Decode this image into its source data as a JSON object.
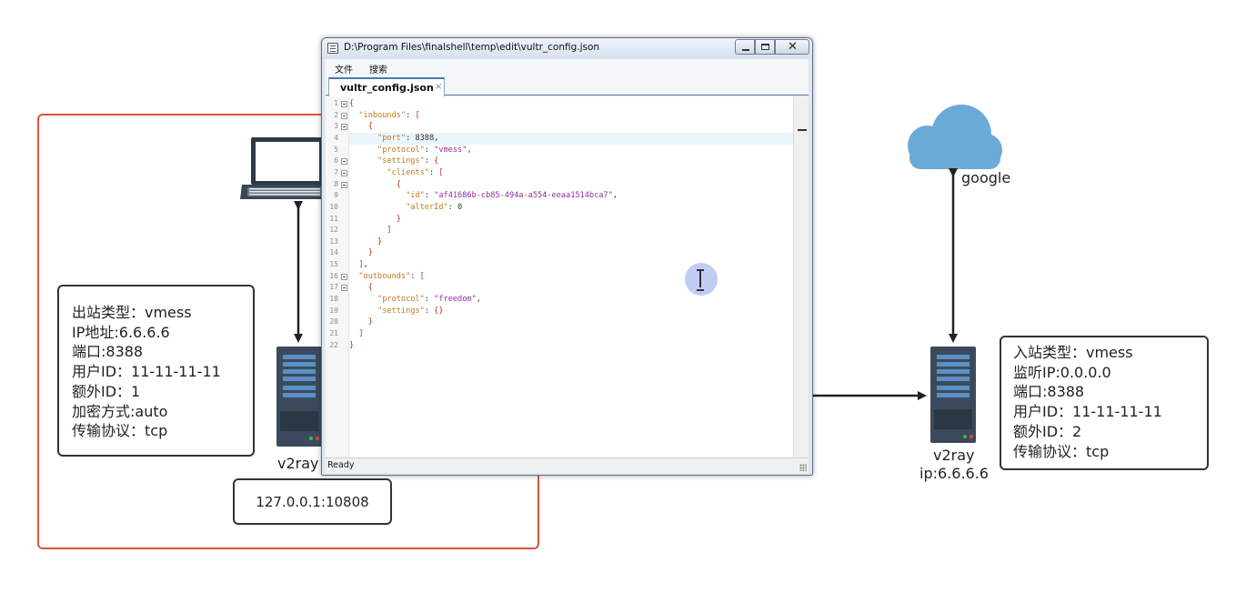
{
  "diagram": {
    "left_info": {
      "lines": [
        "出站类型：vmess",
        "IP地址:6.6.6.6",
        "端口:8388",
        "用户ID：11-11-11-11",
        "额外ID：1",
        "加密方式:auto",
        "传输协议：tcp"
      ]
    },
    "right_info": {
      "lines": [
        "入站类型：vmess",
        "监听IP:0.0.0.0",
        "端口:8388",
        "用户ID：11-11-11-11",
        "额外ID：2",
        "传输协议：tcp"
      ]
    },
    "local_proxy": "127.0.0.1:10808",
    "left_server_label": "v2ray",
    "right_server_label": "v2ray",
    "right_server_ip": "ip:6.6.6.6",
    "cloud_label": "google",
    "colors": {
      "box_border": "#d9553a",
      "cloud": "#6aaad6",
      "server": "#3a4a5c"
    }
  },
  "window": {
    "title": "D:\\Program Files\\finalshell\\temp\\edit\\vultr_config.json",
    "menu": [
      "文件",
      "搜索"
    ],
    "tab": {
      "label": "vultr_config.json",
      "close": "×"
    },
    "status": "Ready",
    "icons": [
      "file-icon",
      "minimize-icon",
      "maximize-icon",
      "close-icon",
      "text-cursor-icon",
      "resize-grip-icon"
    ]
  },
  "code_lines": [
    "{",
    "  \"inbounds\": [",
    "    {",
    "      \"port\": 8388,",
    "      \"protocol\": \"vmess\",",
    "      \"settings\": {",
    "        \"clients\": [",
    "          {",
    "            \"id\": \"af41686b-cb85-494a-a554-eeaa1514bca7\",",
    "            \"alterId\": 0",
    "          }",
    "        ]",
    "      }",
    "    }",
    "  ],",
    "  \"outbounds\": [",
    "    {",
    "      \"protocol\": \"freedom\",",
    "      \"settings\": {}",
    "    }",
    "  ]",
    "}"
  ],
  "line_numbers": [
    "1",
    "2",
    "3",
    "4",
    "5",
    "6",
    "7",
    "8",
    "9",
    "10",
    "11",
    "12",
    "13",
    "14",
    "15",
    "16",
    "17",
    "18",
    "19",
    "20",
    "21",
    "22"
  ],
  "fold_lines": [
    1,
    2,
    3,
    6,
    7,
    8,
    16,
    17
  ],
  "current_line": 4
}
